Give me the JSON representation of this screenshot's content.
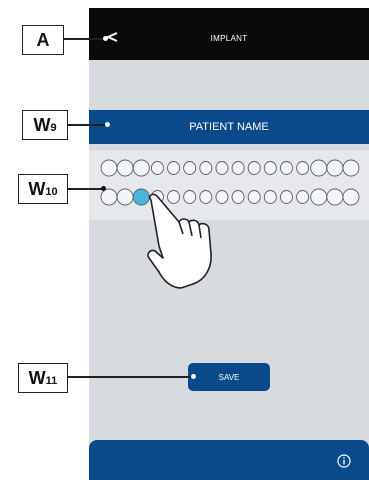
{
  "header": {
    "title": "IMPLANT"
  },
  "patient": {
    "label": "PATIENT NAME"
  },
  "actions": {
    "save_label": "SAVE"
  },
  "callouts": [
    {
      "main": "A",
      "sub": ""
    },
    {
      "main": "W",
      "sub": "9"
    },
    {
      "main": "W",
      "sub": "10"
    },
    {
      "main": "W",
      "sub": "11"
    }
  ],
  "colors": {
    "topbar": "#0a0a0a",
    "accent": "#0b4a8a",
    "background": "#d7dadf",
    "selected_tooth": "#49b6e0"
  },
  "teeth": {
    "upper_count": 16,
    "lower_count": 16,
    "selected": {
      "row": "lower",
      "index": 2
    }
  }
}
